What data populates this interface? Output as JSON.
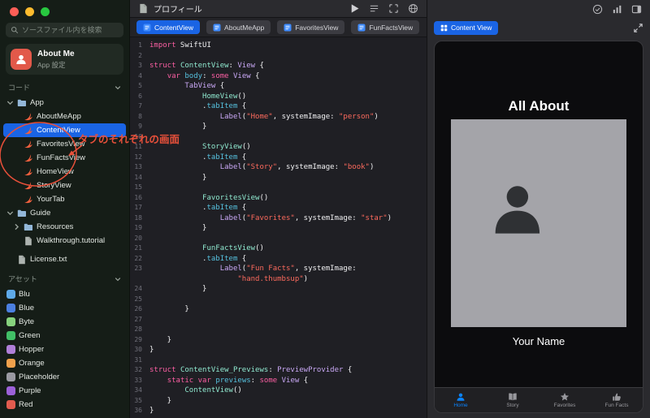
{
  "colors": {
    "selection_blue": "#1a64e4",
    "annotation_orange": "#e8503a",
    "preview_active_blue": "#0a84ff",
    "swift_orange": "#f0603e"
  },
  "window": {
    "traffic_lights": [
      {
        "name": "close-button",
        "color": "#ff5f57"
      },
      {
        "name": "minimize-button",
        "color": "#febc2e"
      },
      {
        "name": "zoom-button",
        "color": "#28c840"
      }
    ],
    "toolbar_icons": [
      "check-circle-icon",
      "chart-icon",
      "inspector-toggle-icon"
    ]
  },
  "sidebar": {
    "search_placeholder": "ソースファイル内を検索",
    "app_card": {
      "title": "About Me",
      "subtitle": "App 設定"
    },
    "sections": {
      "code": "コード",
      "assets": "アセット"
    },
    "code_items": [
      {
        "label": "App",
        "icon": "folder-icon",
        "level": 0,
        "chevron": "down"
      },
      {
        "label": "AboutMeApp",
        "icon": "swift-file-icon",
        "level": 1
      },
      {
        "label": "ContentView",
        "icon": "swift-file-icon",
        "level": 1,
        "selected": true
      },
      {
        "label": "FavoritesView",
        "icon": "swift-file-icon",
        "level": 1
      },
      {
        "label": "FunFactsView",
        "icon": "swift-file-icon",
        "level": 1
      },
      {
        "label": "HomeView",
        "icon": "swift-file-icon",
        "level": 1
      },
      {
        "label": "StoryView",
        "icon": "swift-file-icon",
        "level": 1
      },
      {
        "label": "YourTab",
        "icon": "swift-file-icon",
        "level": 1
      },
      {
        "label": "Guide",
        "icon": "folder-icon",
        "level": 0,
        "chevron": "down"
      },
      {
        "label": "Resources",
        "icon": "folder-icon",
        "level": 1,
        "chevron": "right"
      },
      {
        "label": "Walkthrough.tutorial",
        "icon": "doc-icon",
        "level": 1
      },
      {
        "label": "License.txt",
        "icon": "doc-icon",
        "level": 0,
        "gap_before": true
      }
    ],
    "assets": [
      {
        "label": "Blu",
        "color": "#5ea9e8"
      },
      {
        "label": "Blue",
        "color": "#4b7fe0"
      },
      {
        "label": "Byte",
        "color": "#86d27d"
      },
      {
        "label": "Green",
        "color": "#41bf66"
      },
      {
        "label": "Hopper",
        "color": "#b07fd8"
      },
      {
        "label": "Orange",
        "color": "#f0a14c"
      },
      {
        "label": "Placeholder",
        "color": "#9a9aa2"
      },
      {
        "label": "Purple",
        "color": "#9c61d8"
      },
      {
        "label": "Red",
        "color": "#e25c4f"
      }
    ]
  },
  "annotation": {
    "text": "タブのそれぞれの画面"
  },
  "editor": {
    "title": "プロフィール",
    "toolbar_icons": [
      "play-icon",
      "console-icon",
      "viewfinder-icon",
      "globe-icon"
    ],
    "tabs": [
      {
        "label": "ContentView",
        "active": true
      },
      {
        "label": "AboutMeApp",
        "active": false
      },
      {
        "label": "FavoritesView",
        "active": false
      },
      {
        "label": "FunFactsView",
        "active": false
      }
    ],
    "code": {
      "lines": [
        {
          "n": "1",
          "t": [
            [
              "k",
              "import"
            ],
            [
              "p",
              " SwiftUI"
            ]
          ]
        },
        {
          "n": "2",
          "t": []
        },
        {
          "n": "3",
          "t": [
            [
              "k",
              "struct"
            ],
            [
              "p",
              " "
            ],
            [
              "tp",
              "ContentView"
            ],
            [
              "p",
              ": "
            ],
            [
              "tf",
              "View"
            ],
            [
              "p",
              " {"
            ]
          ]
        },
        {
          "n": "4",
          "t": [
            [
              "p",
              "    "
            ],
            [
              "k",
              "var"
            ],
            [
              "p",
              " "
            ],
            [
              "pr",
              "body"
            ],
            [
              "p",
              ": "
            ],
            [
              "k",
              "some"
            ],
            [
              "p",
              " "
            ],
            [
              "tf",
              "View"
            ],
            [
              "p",
              " {"
            ]
          ]
        },
        {
          "n": "5",
          "t": [
            [
              "p",
              "        "
            ],
            [
              "tf",
              "TabView"
            ],
            [
              "p",
              " {"
            ]
          ]
        },
        {
          "n": "6",
          "t": [
            [
              "p",
              "            "
            ],
            [
              "tp",
              "HomeView"
            ],
            [
              "p",
              "()"
            ]
          ]
        },
        {
          "n": "7",
          "t": [
            [
              "p",
              "            ."
            ],
            [
              "pr",
              "tabItem"
            ],
            [
              "p",
              " {"
            ]
          ]
        },
        {
          "n": "8",
          "t": [
            [
              "p",
              "                "
            ],
            [
              "tf",
              "Label"
            ],
            [
              "p",
              "("
            ],
            [
              "s",
              "\"Home\""
            ],
            [
              "p",
              ", systemImage: "
            ],
            [
              "s",
              "\"person\""
            ],
            [
              "p",
              ")"
            ]
          ]
        },
        {
          "n": "9",
          "t": [
            [
              "p",
              "            }"
            ]
          ]
        },
        {
          "n": "10",
          "t": []
        },
        {
          "n": "11",
          "t": [
            [
              "p",
              "            "
            ],
            [
              "tp",
              "StoryView"
            ],
            [
              "p",
              "()"
            ]
          ]
        },
        {
          "n": "12",
          "t": [
            [
              "p",
              "            ."
            ],
            [
              "pr",
              "tabItem"
            ],
            [
              "p",
              " {"
            ]
          ]
        },
        {
          "n": "13",
          "t": [
            [
              "p",
              "                "
            ],
            [
              "tf",
              "Label"
            ],
            [
              "p",
              "("
            ],
            [
              "s",
              "\"Story\""
            ],
            [
              "p",
              ", systemImage: "
            ],
            [
              "s",
              "\"book\""
            ],
            [
              "p",
              ")"
            ]
          ]
        },
        {
          "n": "14",
          "t": [
            [
              "p",
              "            }"
            ]
          ]
        },
        {
          "n": "15",
          "t": []
        },
        {
          "n": "16",
          "t": [
            [
              "p",
              "            "
            ],
            [
              "tp",
              "FavoritesView"
            ],
            [
              "p",
              "()"
            ]
          ]
        },
        {
          "n": "17",
          "t": [
            [
              "p",
              "            ."
            ],
            [
              "pr",
              "tabItem"
            ],
            [
              "p",
              " {"
            ]
          ]
        },
        {
          "n": "18",
          "t": [
            [
              "p",
              "                "
            ],
            [
              "tf",
              "Label"
            ],
            [
              "p",
              "("
            ],
            [
              "s",
              "\"Favorites\""
            ],
            [
              "p",
              ", systemImage: "
            ],
            [
              "s",
              "\"star\""
            ],
            [
              "p",
              ")"
            ]
          ]
        },
        {
          "n": "19",
          "t": [
            [
              "p",
              "            }"
            ]
          ]
        },
        {
          "n": "20",
          "t": []
        },
        {
          "n": "21",
          "t": [
            [
              "p",
              "            "
            ],
            [
              "tp",
              "FunFactsView"
            ],
            [
              "p",
              "()"
            ]
          ]
        },
        {
          "n": "22",
          "t": [
            [
              "p",
              "            ."
            ],
            [
              "pr",
              "tabItem"
            ],
            [
              "p",
              " {"
            ]
          ]
        },
        {
          "n": "23",
          "t": [
            [
              "p",
              "                "
            ],
            [
              "tf",
              "Label"
            ],
            [
              "p",
              "("
            ],
            [
              "s",
              "\"Fun Facts\""
            ],
            [
              "p",
              ", systemImage:"
            ]
          ]
        },
        {
          "n": "",
          "t": [
            [
              "p",
              "                    "
            ],
            [
              "s",
              "\"hand.thumbsup\""
            ],
            [
              "p",
              ")"
            ]
          ]
        },
        {
          "n": "24",
          "t": [
            [
              "p",
              "            }"
            ]
          ]
        },
        {
          "n": "25",
          "t": []
        },
        {
          "n": "26",
          "t": [
            [
              "p",
              "        }"
            ]
          ]
        },
        {
          "n": "27",
          "t": []
        },
        {
          "n": "28",
          "t": []
        },
        {
          "n": "29",
          "t": [
            [
              "p",
              "    }"
            ]
          ]
        },
        {
          "n": "30",
          "t": [
            [
              "p",
              "}"
            ]
          ]
        },
        {
          "n": "31",
          "t": []
        },
        {
          "n": "32",
          "t": [
            [
              "k",
              "struct"
            ],
            [
              "p",
              " "
            ],
            [
              "tp",
              "ContentView_Previews"
            ],
            [
              "p",
              ": "
            ],
            [
              "tf",
              "PreviewProvider"
            ],
            [
              "p",
              " {"
            ]
          ]
        },
        {
          "n": "33",
          "t": [
            [
              "p",
              "    "
            ],
            [
              "k",
              "static"
            ],
            [
              "p",
              " "
            ],
            [
              "k",
              "var"
            ],
            [
              "p",
              " "
            ],
            [
              "pr",
              "previews"
            ],
            [
              "p",
              ": "
            ],
            [
              "k",
              "some"
            ],
            [
              "p",
              " "
            ],
            [
              "tf",
              "View"
            ],
            [
              "p",
              " {"
            ]
          ]
        },
        {
          "n": "34",
          "t": [
            [
              "p",
              "        "
            ],
            [
              "tp",
              "ContentView"
            ],
            [
              "p",
              "()"
            ]
          ]
        },
        {
          "n": "35",
          "t": [
            [
              "p",
              "    }"
            ]
          ]
        },
        {
          "n": "36",
          "t": [
            [
              "p",
              "}"
            ]
          ]
        }
      ]
    }
  },
  "preview": {
    "tab_label": "Content View",
    "app": {
      "title": "All About",
      "name": "Your Name",
      "tabbar": [
        {
          "label": "Home",
          "icon": "person",
          "active": true
        },
        {
          "label": "Story",
          "icon": "book",
          "active": false
        },
        {
          "label": "Favorites",
          "icon": "star",
          "active": false
        },
        {
          "label": "Fun Facts",
          "icon": "thumbsup",
          "active": false
        }
      ]
    }
  }
}
